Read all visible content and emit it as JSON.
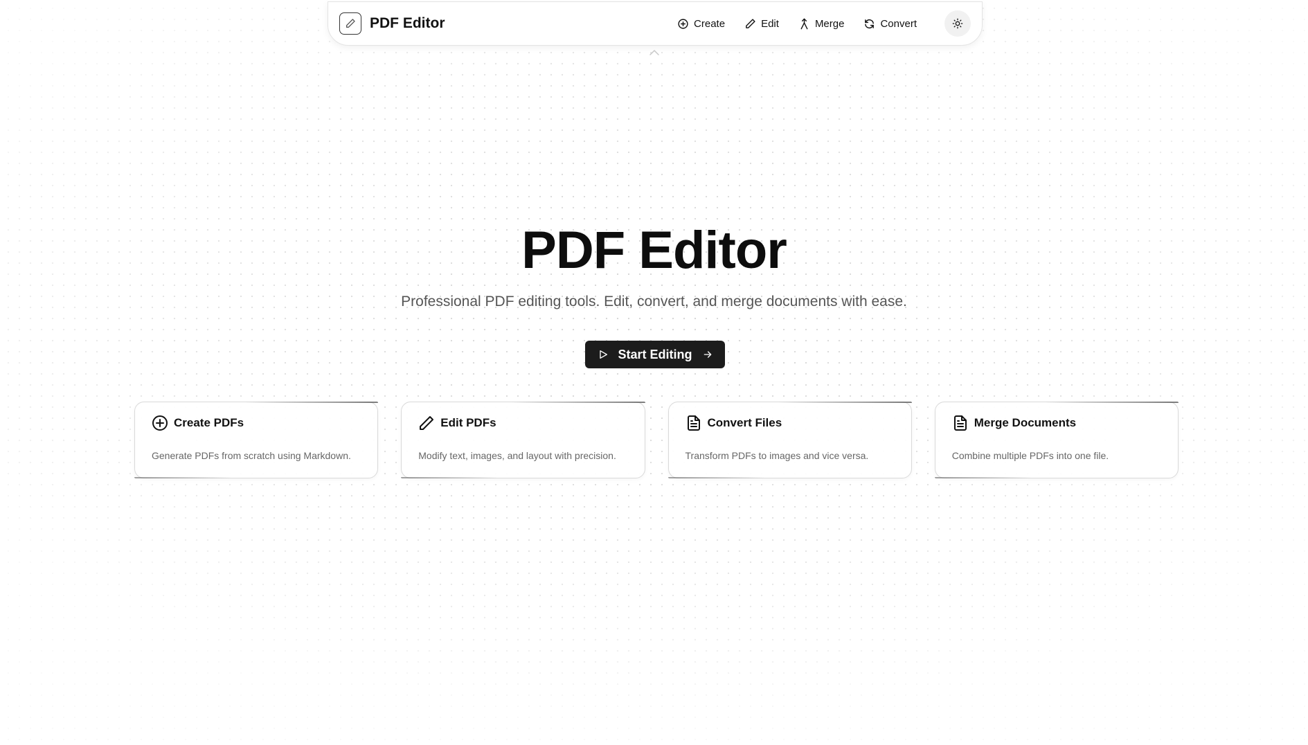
{
  "nav": {
    "brand": "PDF Editor",
    "links": [
      {
        "label": "Create",
        "icon": "plus-circle-icon"
      },
      {
        "label": "Edit",
        "icon": "pencil-icon"
      },
      {
        "label": "Merge",
        "icon": "merge-icon"
      },
      {
        "label": "Convert",
        "icon": "refresh-icon"
      }
    ],
    "theme_toggle_icon": "sun-icon"
  },
  "hero": {
    "title": "PDF Editor",
    "subtitle": "Professional PDF editing tools. Edit, convert, and merge documents with ease.",
    "cta_label": "Start Editing"
  },
  "cards": [
    {
      "title": "Create PDFs",
      "description": "Generate PDFs from scratch using Markdown.",
      "icon": "plus-circle-icon"
    },
    {
      "title": "Edit PDFs",
      "description": "Modify text, images, and layout with precision.",
      "icon": "pencil-icon"
    },
    {
      "title": "Convert Files",
      "description": "Transform PDFs to images and vice versa.",
      "icon": "file-text-icon"
    },
    {
      "title": "Merge Documents",
      "description": "Combine multiple PDFs into one file.",
      "icon": "file-text-icon"
    }
  ],
  "colors": {
    "background": "#ffffff",
    "dot_grid": "#d6d6d6",
    "cta_bg": "#1c1c1c",
    "text_primary": "#111111",
    "text_secondary": "#555555"
  }
}
